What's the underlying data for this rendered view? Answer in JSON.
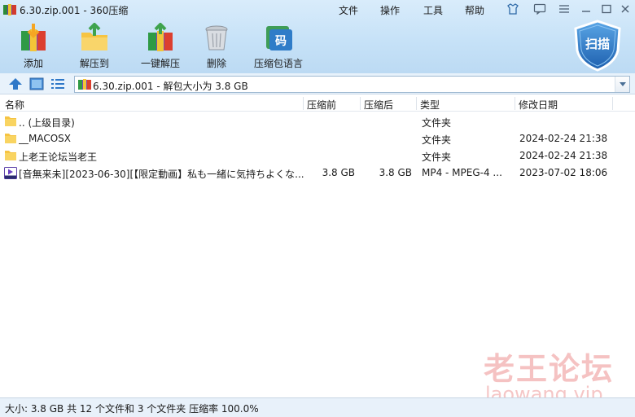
{
  "window": {
    "title": "6.30.zip.001 - 360压缩",
    "menus": [
      "文件",
      "操作",
      "工具",
      "帮助"
    ]
  },
  "toolbar": {
    "buttons": [
      {
        "label": "添加",
        "icon": "add-archive-icon"
      },
      {
        "label": "解压到",
        "icon": "extract-to-icon"
      },
      {
        "label": "一键解压",
        "icon": "one-click-extract-icon"
      },
      {
        "label": "删除",
        "icon": "delete-icon"
      },
      {
        "label": "压缩包语言",
        "icon": "archive-language-icon"
      }
    ],
    "language_icon_glyph": "码",
    "scan_label": "扫描"
  },
  "path": {
    "text": "6.30.zip.001 - 解包大小为 3.8 GB"
  },
  "columns": [
    "名称",
    "压缩前",
    "压缩后",
    "类型",
    "修改日期"
  ],
  "rows": [
    {
      "name": ".. (上级目录)",
      "size": "",
      "packed": "",
      "type": "文件夹",
      "modified": "",
      "kind": "folder"
    },
    {
      "name": "__MACOSX",
      "size": "",
      "packed": "",
      "type": "文件夹",
      "modified": "2024-02-24 21:38",
      "kind": "folder"
    },
    {
      "name": "上老王论坛当老王",
      "size": "",
      "packed": "",
      "type": "文件夹",
      "modified": "2024-02-24 21:38",
      "kind": "folder"
    },
    {
      "name": "[音無来未][2023-06-30][【限定動画】私も一緒に気持ちよくな...",
      "size": "3.8 GB",
      "packed": "3.8 GB",
      "type": "MP4 - MPEG-4 ...",
      "modified": "2023-07-02 18:06",
      "kind": "video"
    }
  ],
  "watermark": {
    "line1": "老王论坛",
    "line2": "laowang.vip"
  },
  "status": {
    "text": "大小: 3.8 GB 共 12 个文件和 3 个文件夹 压缩率 100.0%"
  },
  "colors": {
    "accent": "#2f78c8",
    "folder": "#f6c443",
    "watermark": "#e87878"
  }
}
